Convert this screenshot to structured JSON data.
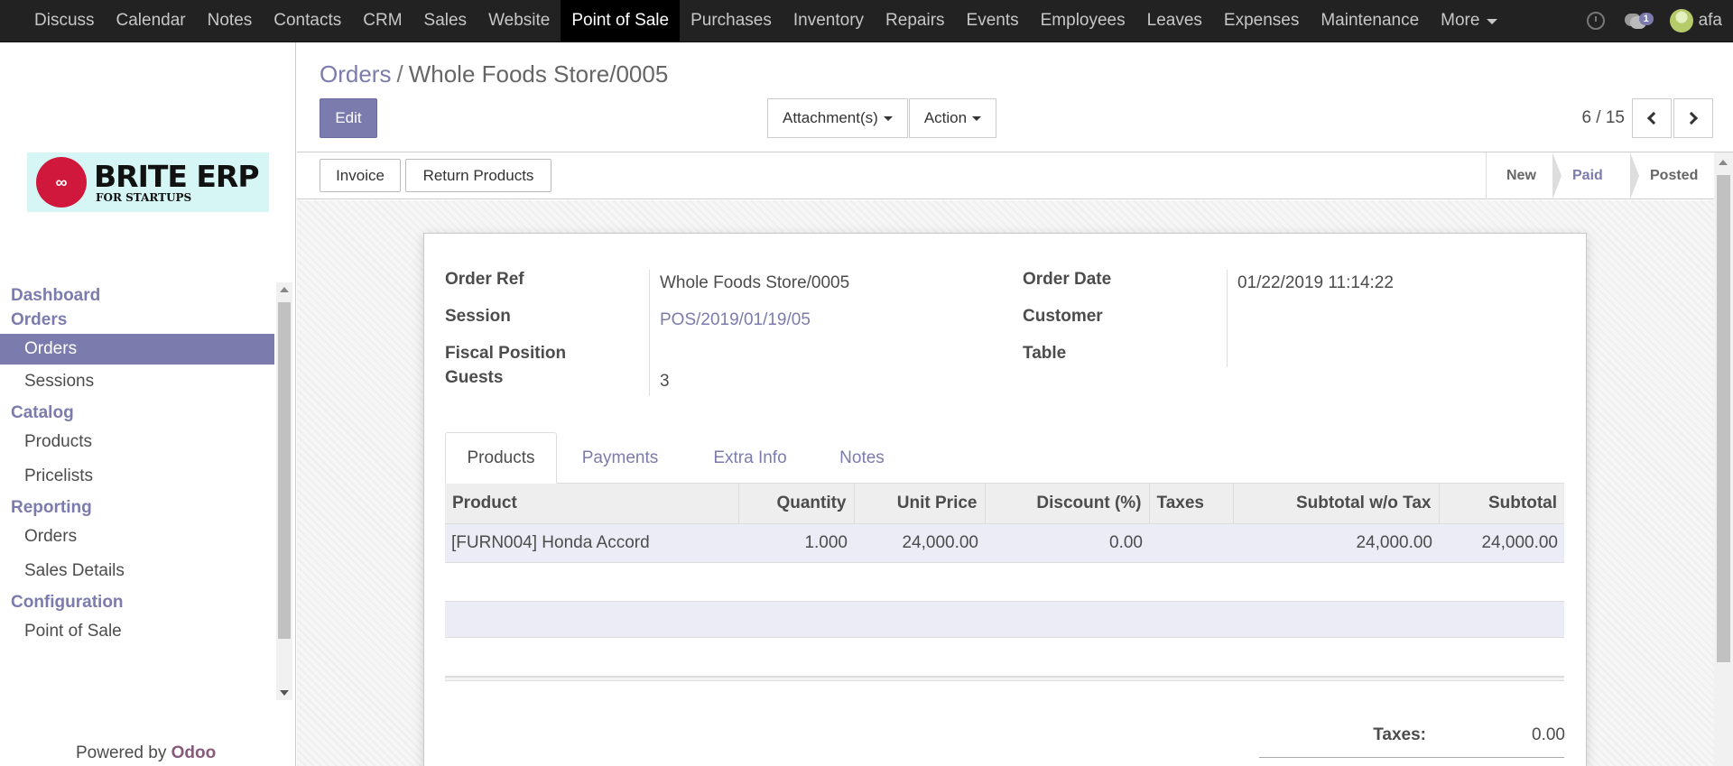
{
  "navbar": {
    "menu": [
      "Discuss",
      "Calendar",
      "Notes",
      "Contacts",
      "CRM",
      "Sales",
      "Website",
      "Point of Sale",
      "Purchases",
      "Inventory",
      "Repairs",
      "Events",
      "Employees",
      "Leaves",
      "Expenses",
      "Maintenance"
    ],
    "more_label": "More",
    "chat_badge": "1",
    "user_name": "afa"
  },
  "logo": {
    "brand": "BRITE ERP",
    "tagline": "FOR STARTUPS"
  },
  "sidebar": {
    "dashboard": "Dashboard",
    "orders_section": "Orders",
    "orders_items": [
      "Orders",
      "Sessions"
    ],
    "catalog_section": "Catalog",
    "catalog_items": [
      "Products",
      "Pricelists"
    ],
    "reporting_section": "Reporting",
    "reporting_items": [
      "Orders",
      "Sales Details"
    ],
    "configuration_section": "Configuration",
    "configuration_items": [
      "Point of Sale"
    ],
    "powered_by": "Powered by",
    "powered_brand": "Odoo"
  },
  "control": {
    "breadcrumb_parent": "Orders",
    "breadcrumb_sep": "/",
    "breadcrumb_current": "Whole Foods Store/0005",
    "edit_label": "Edit",
    "attachments_label": "Attachment(s)",
    "action_label": "Action",
    "pager": "6 / 15"
  },
  "statusbar": {
    "invoice_label": "Invoice",
    "return_label": "Return Products",
    "stages": [
      "New",
      "Paid",
      "Posted"
    ],
    "current_stage": "Paid"
  },
  "form": {
    "order_ref_label": "Order Ref",
    "order_ref": "Whole Foods Store/0005",
    "session_label": "Session",
    "session": "POS/2019/01/19/05",
    "fiscal_label": "Fiscal Position",
    "guests_label": "Guests",
    "guests": "3",
    "order_date_label": "Order Date",
    "order_date": "01/22/2019 11:14:22",
    "customer_label": "Customer",
    "table_label": "Table"
  },
  "tabs": [
    "Products",
    "Payments",
    "Extra Info",
    "Notes"
  ],
  "lines": {
    "headers": [
      "Product",
      "Quantity",
      "Unit Price",
      "Discount (%)",
      "Taxes",
      "Subtotal w/o Tax",
      "Subtotal"
    ],
    "rows": [
      [
        "[FURN004] Honda Accord",
        "1.000",
        "24,000.00",
        "0.00",
        "",
        "24,000.00",
        "24,000.00"
      ]
    ]
  },
  "totals": {
    "taxes_label": "Taxes:",
    "taxes_value": "0.00"
  },
  "colors": {
    "accent": "#7c7bad",
    "navbar": "#222222",
    "logo_red": "#d0183c"
  }
}
